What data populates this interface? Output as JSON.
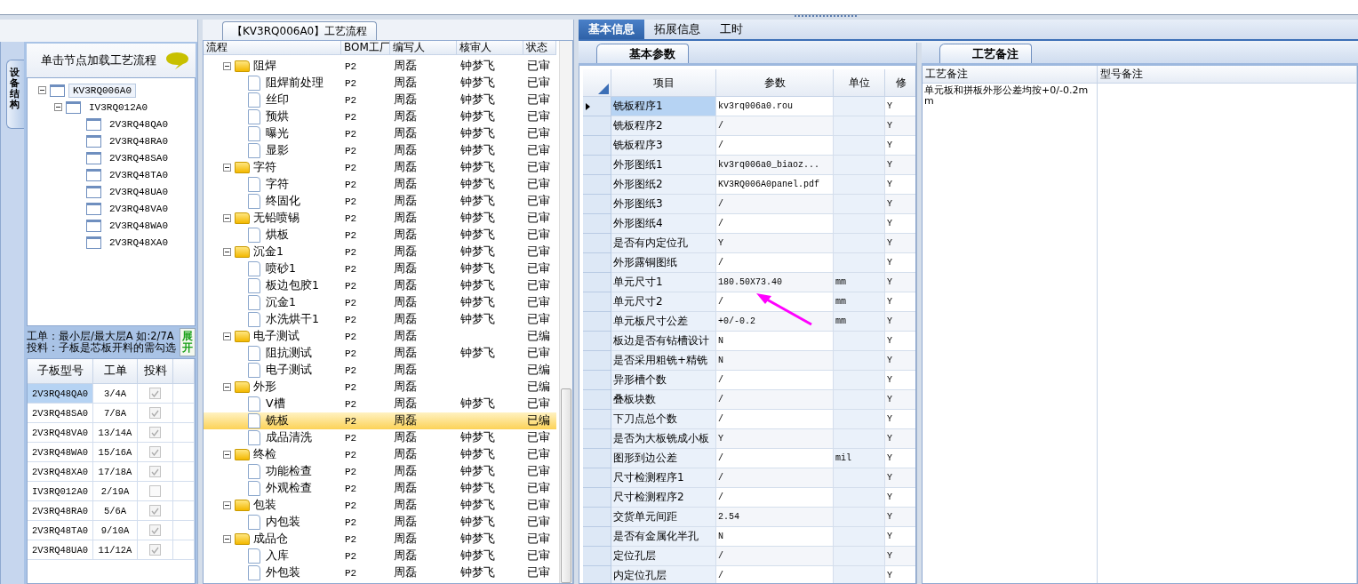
{
  "left": {
    "vertical_tab": "设备结构",
    "hint": "单击节点加载工艺流程",
    "tree": {
      "label": "KV3RQ006A0",
      "expanded": true,
      "selected": true,
      "children": [
        {
          "label": "IV3RQ012A0",
          "expanded": true,
          "selected": false,
          "children": [
            {
              "label": "2V3RQ48QA0",
              "selected": false
            },
            {
              "label": "2V3RQ48RA0",
              "selected": false
            },
            {
              "label": "2V3RQ48SA0",
              "selected": false
            },
            {
              "label": "2V3RQ48TA0",
              "selected": false
            },
            {
              "label": "2V3RQ48UA0",
              "selected": false
            },
            {
              "label": "2V3RQ48VA0",
              "selected": false
            },
            {
              "label": "2V3RQ48WA0",
              "selected": false
            },
            {
              "label": "2V3RQ48XA0",
              "selected": false
            }
          ]
        }
      ]
    },
    "info_lines": [
      "工单：最小层/最大层A 如:2/7A",
      "投料：子板是芯板开料的需勾选"
    ],
    "expand_button": "展开",
    "columns": [
      "子板型号",
      "工单",
      "投料"
    ],
    "rows": [
      {
        "model": "2V3RQ48QA0",
        "order": "3/4A",
        "checked": true,
        "selected": true
      },
      {
        "model": "2V3RQ48SA0",
        "order": "7/8A",
        "checked": true,
        "selected": false
      },
      {
        "model": "2V3RQ48VA0",
        "order": "13/14A",
        "checked": true,
        "selected": false
      },
      {
        "model": "2V3RQ48WA0",
        "order": "15/16A",
        "checked": true,
        "selected": false
      },
      {
        "model": "2V3RQ48XA0",
        "order": "17/18A",
        "checked": true,
        "selected": false
      },
      {
        "model": "IV3RQ012A0",
        "order": "2/19A",
        "checked": false,
        "selected": false
      },
      {
        "model": "2V3RQ48RA0",
        "order": "5/6A",
        "checked": true,
        "selected": false
      },
      {
        "model": "2V3RQ48TA0",
        "order": "9/10A",
        "checked": true,
        "selected": false
      },
      {
        "model": "2V3RQ48UA0",
        "order": "11/12A",
        "checked": true,
        "selected": false
      }
    ]
  },
  "flow": {
    "title": "【KV3RQ006A0】工艺流程",
    "columns": [
      "流程",
      "BOM工厂",
      "编写人",
      "核审人",
      "状态"
    ],
    "rows": [
      {
        "kind": "folder",
        "label": "阻焊",
        "bom": "P2",
        "writer": "周磊",
        "reviewer": "钟梦飞",
        "status": "已审",
        "expanded": true,
        "selected": false,
        "children": [
          {
            "kind": "file",
            "label": "阻焊前处理",
            "bom": "P2",
            "writer": "周磊",
            "reviewer": "钟梦飞",
            "status": "已审",
            "selected": false
          },
          {
            "kind": "file",
            "label": "丝印",
            "bom": "P2",
            "writer": "周磊",
            "reviewer": "钟梦飞",
            "status": "已审",
            "selected": false
          },
          {
            "kind": "file",
            "label": "预烘",
            "bom": "P2",
            "writer": "周磊",
            "reviewer": "钟梦飞",
            "status": "已审",
            "selected": false
          },
          {
            "kind": "file",
            "label": "曝光",
            "bom": "P2",
            "writer": "周磊",
            "reviewer": "钟梦飞",
            "status": "已审",
            "selected": false
          },
          {
            "kind": "file",
            "label": "显影",
            "bom": "P2",
            "writer": "周磊",
            "reviewer": "钟梦飞",
            "status": "已审",
            "selected": false
          }
        ]
      },
      {
        "kind": "folder",
        "label": "字符",
        "bom": "P2",
        "writer": "周磊",
        "reviewer": "钟梦飞",
        "status": "已审",
        "expanded": true,
        "selected": false,
        "children": [
          {
            "kind": "file",
            "label": "字符",
            "bom": "P2",
            "writer": "周磊",
            "reviewer": "钟梦飞",
            "status": "已审",
            "selected": false
          },
          {
            "kind": "file",
            "label": "终固化",
            "bom": "P2",
            "writer": "周磊",
            "reviewer": "钟梦飞",
            "status": "已审",
            "selected": false
          }
        ]
      },
      {
        "kind": "folder",
        "label": "无铅喷锡",
        "bom": "P2",
        "writer": "周磊",
        "reviewer": "钟梦飞",
        "status": "已审",
        "expanded": true,
        "selected": false,
        "children": [
          {
            "kind": "file",
            "label": "烘板",
            "bom": "P2",
            "writer": "周磊",
            "reviewer": "钟梦飞",
            "status": "已审",
            "selected": false
          }
        ]
      },
      {
        "kind": "folder",
        "label": "沉金1",
        "bom": "P2",
        "writer": "周磊",
        "reviewer": "钟梦飞",
        "status": "已审",
        "expanded": true,
        "selected": false,
        "children": [
          {
            "kind": "file",
            "label": "喷砂1",
            "bom": "P2",
            "writer": "周磊",
            "reviewer": "钟梦飞",
            "status": "已审",
            "selected": false
          },
          {
            "kind": "file",
            "label": "板边包胶1",
            "bom": "P2",
            "writer": "周磊",
            "reviewer": "钟梦飞",
            "status": "已审",
            "selected": false
          },
          {
            "kind": "file",
            "label": "沉金1",
            "bom": "P2",
            "writer": "周磊",
            "reviewer": "钟梦飞",
            "status": "已审",
            "selected": false
          },
          {
            "kind": "file",
            "label": "水洗烘干1",
            "bom": "P2",
            "writer": "周磊",
            "reviewer": "钟梦飞",
            "status": "已审",
            "selected": false
          }
        ]
      },
      {
        "kind": "folder",
        "label": "电子测试",
        "bom": "P2",
        "writer": "周磊",
        "status": "已编",
        "expanded": true,
        "selected": false,
        "children": [
          {
            "kind": "file",
            "label": "阻抗测试",
            "bom": "P2",
            "writer": "周磊",
            "reviewer": "钟梦飞",
            "status": "已审",
            "selected": false
          },
          {
            "kind": "file",
            "label": "电子测试",
            "bom": "P2",
            "writer": "周磊",
            "status": "已编",
            "selected": false
          }
        ]
      },
      {
        "kind": "folder",
        "label": "外形",
        "bom": "P2",
        "writer": "周磊",
        "status": "已编",
        "expanded": true,
        "selected": false,
        "children": [
          {
            "kind": "file",
            "label": "V槽",
            "bom": "P2",
            "writer": "周磊",
            "reviewer": "钟梦飞",
            "status": "已审",
            "selected": false
          },
          {
            "kind": "file",
            "label": "铣板",
            "bom": "P2",
            "writer": "周磊",
            "status": "已编",
            "selected": true
          },
          {
            "kind": "file",
            "label": "成品清洗",
            "bom": "P2",
            "writer": "周磊",
            "reviewer": "钟梦飞",
            "status": "已审",
            "selected": false
          }
        ]
      },
      {
        "kind": "folder",
        "label": "终检",
        "bom": "P2",
        "writer": "周磊",
        "reviewer": "钟梦飞",
        "status": "已审",
        "expanded": true,
        "selected": false,
        "children": [
          {
            "kind": "file",
            "label": "功能检查",
            "bom": "P2",
            "writer": "周磊",
            "reviewer": "钟梦飞",
            "status": "已审",
            "selected": false
          },
          {
            "kind": "file",
            "label": "外观检查",
            "bom": "P2",
            "writer": "周磊",
            "reviewer": "钟梦飞",
            "status": "已审",
            "selected": false
          }
        ]
      },
      {
        "kind": "folder",
        "label": "包装",
        "bom": "P2",
        "writer": "周磊",
        "reviewer": "钟梦飞",
        "status": "已审",
        "expanded": true,
        "selected": false,
        "children": [
          {
            "kind": "file",
            "label": "内包装",
            "bom": "P2",
            "writer": "周磊",
            "reviewer": "钟梦飞",
            "status": "已审",
            "selected": false
          }
        ]
      },
      {
        "kind": "folder",
        "label": "成品仓",
        "bom": "P2",
        "writer": "周磊",
        "reviewer": "钟梦飞",
        "status": "已审",
        "expanded": true,
        "selected": false,
        "children": [
          {
            "kind": "file",
            "label": "入库",
            "bom": "P2",
            "writer": "周磊",
            "reviewer": "钟梦飞",
            "status": "已审",
            "selected": false
          },
          {
            "kind": "file",
            "label": "外包装",
            "bom": "P2",
            "writer": "周磊",
            "reviewer": "钟梦飞",
            "status": "已审",
            "selected": false
          }
        ]
      }
    ]
  },
  "tabs": [
    {
      "label": "基本信息",
      "selected": true
    },
    {
      "label": "拓展信息",
      "selected": false
    },
    {
      "label": "工时",
      "selected": false
    }
  ],
  "params": {
    "tab": "基本参数",
    "columns": [
      "项目",
      "参数",
      "单位",
      "修"
    ],
    "rows": [
      {
        "item": "铣板程序1",
        "value": "kv3rq006a0.rou",
        "flag": "Y",
        "selected": true
      },
      {
        "item": "铣板程序2",
        "value": "/",
        "flag": "Y",
        "selected": false
      },
      {
        "item": "铣板程序3",
        "value": "/",
        "flag": "Y",
        "selected": false
      },
      {
        "item": "外形图纸1",
        "value": "kv3rq006a0_biaoz...",
        "flag": "Y",
        "selected": false
      },
      {
        "item": "外形图纸2",
        "value": "KV3RQ006A0panel.pdf",
        "flag": "Y",
        "selected": false
      },
      {
        "item": "外形图纸3",
        "value": "/",
        "flag": "Y",
        "selected": false
      },
      {
        "item": "外形图纸4",
        "value": "/",
        "flag": "Y",
        "selected": false
      },
      {
        "item": "是否有内定位孔",
        "value": "Y",
        "flag": "Y",
        "selected": false
      },
      {
        "item": "外形露铜图纸",
        "value": "/",
        "flag": "Y",
        "selected": false
      },
      {
        "item": "单元尺寸1",
        "value": "180.50X73.40",
        "unit": "mm",
        "flag": "Y",
        "selected": false
      },
      {
        "item": "单元尺寸2",
        "value": "/",
        "unit": "mm",
        "flag": "Y",
        "selected": false
      },
      {
        "item": "单元板尺寸公差",
        "value": "+0/-0.2",
        "unit": "mm",
        "flag": "Y",
        "selected": false
      },
      {
        "item": "板边是否有钻槽设计",
        "value": "N",
        "flag": "Y",
        "selected": false
      },
      {
        "item": "是否采用粗铣+精铣",
        "value": "N",
        "flag": "Y",
        "selected": false
      },
      {
        "item": "异形槽个数",
        "value": "/",
        "flag": "Y",
        "selected": false
      },
      {
        "item": "叠板块数",
        "value": "/",
        "flag": "Y",
        "selected": false
      },
      {
        "item": "下刀点总个数",
        "value": "/",
        "flag": "Y",
        "selected": false
      },
      {
        "item": "是否为大板铣成小板",
        "value": "Y",
        "flag": "Y",
        "selected": false
      },
      {
        "item": "图形到边公差",
        "value": "/",
        "unit": "mil",
        "flag": "Y",
        "selected": false
      },
      {
        "item": "尺寸检测程序1",
        "value": "/",
        "flag": "Y",
        "selected": false
      },
      {
        "item": "尺寸检测程序2",
        "value": "/",
        "flag": "Y",
        "selected": false
      },
      {
        "item": "交货单元间距",
        "value": "2.54",
        "flag": "Y",
        "selected": false
      },
      {
        "item": "是否有金属化半孔",
        "value": "N",
        "flag": "Y",
        "selected": false
      },
      {
        "item": "定位孔层",
        "value": "/",
        "flag": "Y",
        "selected": false
      },
      {
        "item": "内定位孔层",
        "value": "/",
        "flag": "Y",
        "selected": false
      }
    ]
  },
  "notes": {
    "tab": "工艺备注",
    "columns": [
      "工艺备注",
      "型号备注"
    ],
    "process_note": "单元板和拼板外形公差均按+0/-0.2mm"
  }
}
